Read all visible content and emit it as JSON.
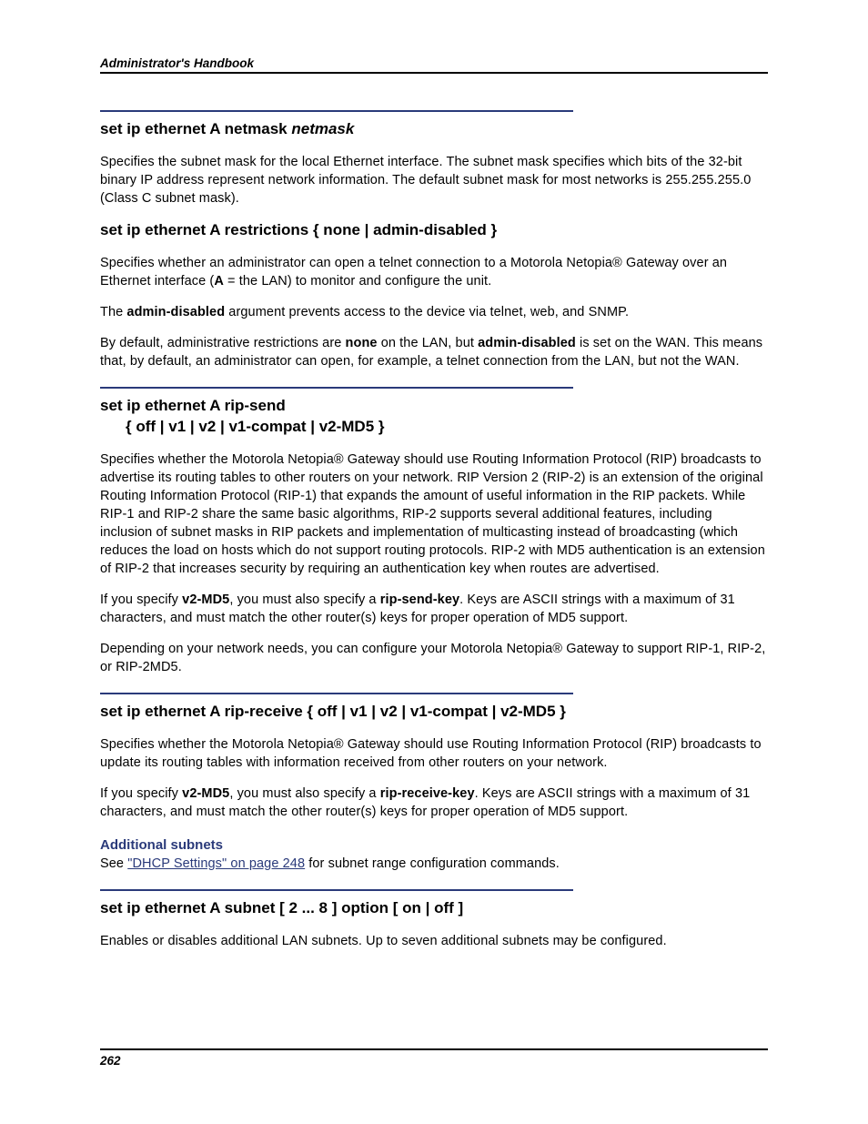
{
  "header": {
    "running_title": "Administrator's Handbook"
  },
  "sections": [
    {
      "heading_plain": "set ip ethernet A netmask ",
      "heading_arg": "netmask",
      "paragraphs": [
        "Specifies the subnet mask for the local Ethernet interface. The subnet mask specifies which bits of the 32-bit binary IP address represent network information. The default subnet mask for most networks is 255.255.255.0 (Class C subnet mask)."
      ],
      "rule_before": true
    },
    {
      "heading_plain": "set ip ethernet A restrictions { none | admin-disabled }",
      "paragraphs_rich": [
        {
          "frags": [
            {
              "t": "Specifies whether an administrator can open a telnet connection to a Motorola Netopia® Gateway over an Ethernet interface ("
            },
            {
              "t": "A",
              "b": true
            },
            {
              "t": " = the LAN) to monitor and configure the unit."
            }
          ]
        },
        {
          "frags": [
            {
              "t": "The "
            },
            {
              "t": "admin-disabled",
              "b": true
            },
            {
              "t": " argument prevents access to the device via telnet, web, and SNMP."
            }
          ]
        },
        {
          "frags": [
            {
              "t": "By default, administrative restrictions are "
            },
            {
              "t": "none",
              "b": true
            },
            {
              "t": " on the LAN, but "
            },
            {
              "t": "admin-disabled",
              "b": true
            },
            {
              "t": " is set on the WAN. This means that, by default, an administrator can open, for example, a telnet connection from the LAN, but not the WAN."
            }
          ]
        }
      ],
      "rule_before": false
    },
    {
      "heading_lines": [
        "set ip ethernet A rip-send ",
        "{ off | v1 | v2 | v1-compat | v2-MD5 }"
      ],
      "paragraphs_rich": [
        {
          "frags": [
            {
              "t": "Specifies whether the Motorola Netopia® Gateway should use Routing Information Protocol (RIP) broadcasts to advertise its routing tables to other routers on your network. RIP Version 2 (RIP-2) is an extension of the original Routing Information Protocol (RIP-1) that expands the amount of useful information in the RIP packets. While RIP-1 and RIP-2 share the same basic algorithms, RIP-2 supports several additional features, including inclusion of subnet masks in RIP packets and implementation of multicasting instead of broadcasting (which reduces the load on hosts which do not support routing protocols. RIP-2 with MD5 authentication is an extension of RIP-2 that increases security by requiring an authentication key when routes are advertised."
            }
          ]
        },
        {
          "frags": [
            {
              "t": "If you specify "
            },
            {
              "t": "v2-MD5",
              "b": true
            },
            {
              "t": ", you must also specify a "
            },
            {
              "t": "rip-send-key",
              "b": true
            },
            {
              "t": ". Keys are ASCII strings with a maximum of 31 characters, and must match the other router(s) keys for proper operation of MD5 support."
            }
          ]
        },
        {
          "frags": [
            {
              "t": "Depending on your network needs, you can configure your Motorola Netopia® Gateway to support RIP-1, RIP-2, or RIP-2MD5."
            }
          ]
        }
      ],
      "rule_before": true
    },
    {
      "heading_plain": "set ip ethernet A rip-receive { off | v1 | v2 | v1-compat | v2-MD5 }",
      "paragraphs_rich": [
        {
          "frags": [
            {
              "t": "Specifies whether the Motorola Netopia® Gateway should use Routing Information Protocol (RIP) broadcasts to update its routing tables with information received from other routers on your network."
            }
          ]
        },
        {
          "frags": [
            {
              "t": "If you specify "
            },
            {
              "t": "v2-MD5",
              "b": true
            },
            {
              "t": ", you must also specify a "
            },
            {
              "t": "rip-receive-key",
              "b": true
            },
            {
              "t": ". Keys are ASCII strings with a maximum of 31 characters, and must match the other router(s) keys for proper operation of MD5 support."
            }
          ]
        }
      ],
      "rule_before": true
    }
  ],
  "subhead": {
    "label": "Additional subnets",
    "see_prefix": "See ",
    "link_text": "\"DHCP Settings\" on page 248",
    "see_suffix": " for subnet range configuration commands."
  },
  "last_section": {
    "heading_plain": "set ip ethernet A subnet [ 2 ... 8 ] option [ on | off ]",
    "paragraph": "Enables or disables additional LAN subnets. Up to seven additional subnets may be configured."
  },
  "footer": {
    "page_number": "262"
  }
}
